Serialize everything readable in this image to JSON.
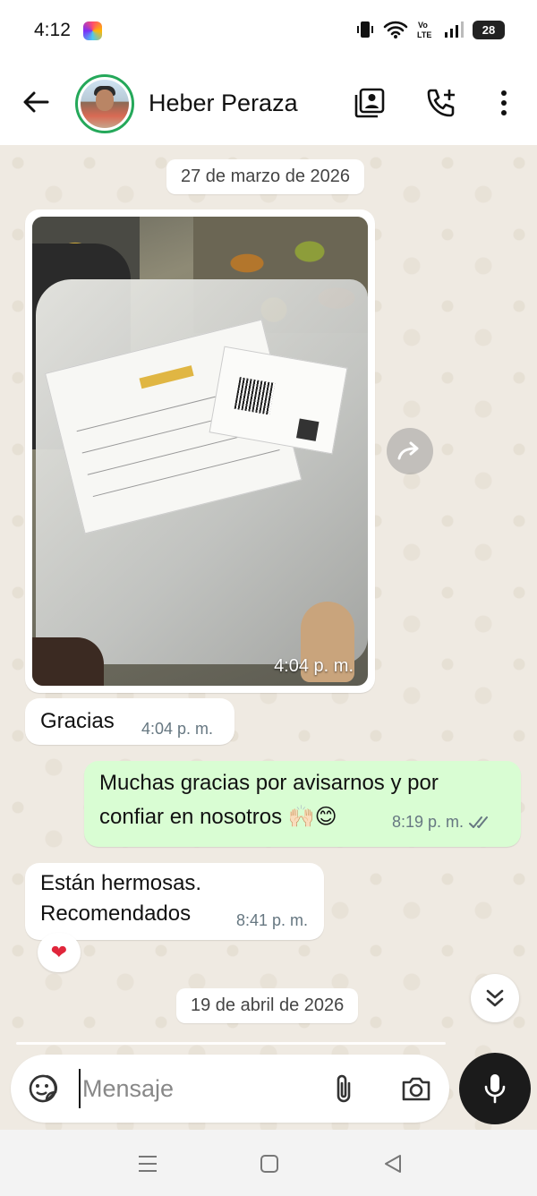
{
  "status_bar": {
    "time": "4:12",
    "battery": "28"
  },
  "header": {
    "contact_name": "Heber Peraza"
  },
  "chat": {
    "dates": [
      "27 de marzo de 2026",
      "19 de abril de 2026"
    ],
    "messages": [
      {
        "type": "image",
        "direction": "incoming",
        "time": "4:04 p. m."
      },
      {
        "type": "text",
        "direction": "incoming",
        "text": "Gracias",
        "time": "4:04 p. m."
      },
      {
        "type": "text",
        "direction": "outgoing",
        "line1": "Muchas gracias por avisarnos y por",
        "line2": "confiar en nosotros 🙌🏻😊",
        "time": "8:19 p. m.",
        "status": "read"
      },
      {
        "type": "text",
        "direction": "incoming",
        "line1": "Están hermosas.",
        "line2": "Recomendados",
        "time": "8:41 p. m.",
        "reaction": "❤"
      }
    ]
  },
  "composer": {
    "placeholder": "Mensaje"
  },
  "colors": {
    "accent": "#25a85a",
    "outgoing_bubble": "#d9fdd3",
    "chat_bg": "#efeae2",
    "read_ticks": "#667781"
  }
}
